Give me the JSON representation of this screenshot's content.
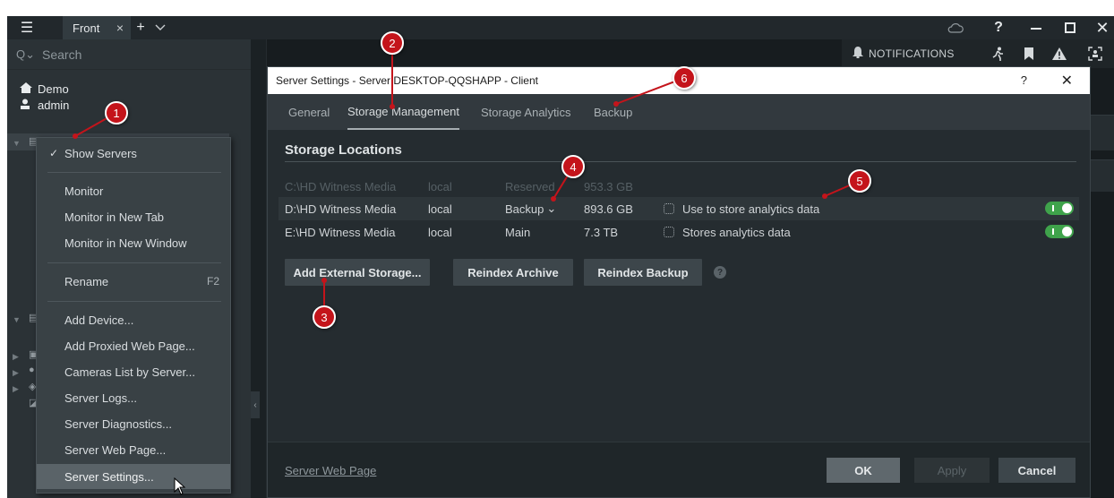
{
  "topbar": {
    "tab_label": "Front",
    "tab_close": "×",
    "add_tab": "+",
    "tab_chevron": "v",
    "help": "?",
    "minimize": "—",
    "maximize": "☐",
    "close": "✕",
    "menu_glyph": "☰",
    "cloud_glyph": "☁"
  },
  "left_panel": {
    "search_placeholder": "Search",
    "search_glyph": "Q⌄",
    "system_name": "Demo",
    "user_name": "admin"
  },
  "notifications": {
    "label": "NOTIFICATIONS"
  },
  "context_menu": {
    "items": [
      {
        "label": "Show Servers",
        "checked": true
      },
      {
        "label": "Monitor"
      },
      {
        "label": "Monitor in New Tab"
      },
      {
        "label": "Monitor in New Window"
      },
      {
        "label": "Rename",
        "shortcut": "F2"
      },
      {
        "label": "Add Device..."
      },
      {
        "label": "Add Proxied Web Page..."
      },
      {
        "label": "Cameras List by Server..."
      },
      {
        "label": "Server Logs..."
      },
      {
        "label": "Server Diagnostics..."
      },
      {
        "label": "Server Web Page..."
      },
      {
        "label": "Server Settings...",
        "hovered": true
      }
    ],
    "check_glyph": "✓"
  },
  "dialog": {
    "title": "Server Settings - Server DESKTOP-QQSHAPP - Client",
    "help": "?",
    "close": "✕",
    "tabs": [
      {
        "label": "General"
      },
      {
        "label": "Storage Management",
        "active": true
      },
      {
        "label": "Storage Analytics"
      },
      {
        "label": "Backup"
      }
    ],
    "section_title": "Storage Locations",
    "storages": [
      {
        "path": "C:\\HD Witness Media",
        "type": "local",
        "role": "Reserved",
        "size": "953.3 GB",
        "analytics": "",
        "enabled": false
      },
      {
        "path": "D:\\HD Witness Media",
        "type": "local",
        "role": "Backup",
        "size": "893.6 GB",
        "analytics": "Use to store analytics data",
        "enabled": true
      },
      {
        "path": "E:\\HD Witness Media",
        "type": "local",
        "role": "Main",
        "size": "7.3 TB",
        "analytics": "Stores analytics data",
        "enabled": true
      }
    ],
    "role_chevron": "⌄",
    "buttons": {
      "add_external": "Add External Storage...",
      "reindex_archive": "Reindex Archive",
      "reindex_backup": "Reindex Backup",
      "help_glyph": "?"
    },
    "footer": {
      "link": "Server Web Page",
      "ok": "OK",
      "apply": "Apply",
      "cancel": "Cancel"
    }
  },
  "annotations": {
    "badges": [
      "1",
      "2",
      "3",
      "4",
      "5",
      "6"
    ],
    "color": "#c4141b"
  }
}
